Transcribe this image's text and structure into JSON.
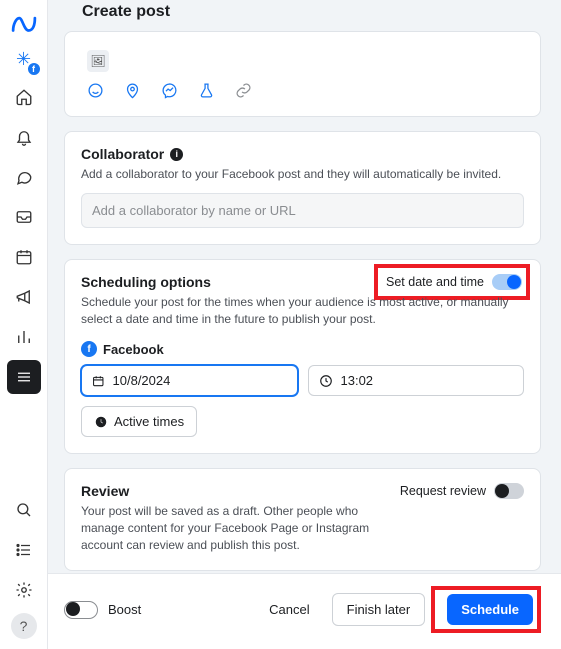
{
  "header": {
    "title": "Create post"
  },
  "collaborator": {
    "title": "Collaborator",
    "desc": "Add a collaborator to your Facebook post and they will automatically be invited.",
    "placeholder": "Add a collaborator by name or URL"
  },
  "scheduling": {
    "title": "Scheduling options",
    "toggle_label": "Set date and time",
    "desc": "Schedule your post for the times when your audience is most active, or manually select a date and time in the future to publish your post.",
    "platform": "Facebook",
    "date_value": "10/8/2024",
    "time_value": "13:02",
    "active_times": "Active times"
  },
  "review": {
    "title": "Review",
    "toggle_label": "Request review",
    "desc": "Your post will be saved as a draft. Other people who manage content for your Facebook Page or Instagram account can review and publish this post."
  },
  "footer": {
    "boost": "Boost",
    "cancel": "Cancel",
    "finish_later": "Finish later",
    "schedule": "Schedule"
  },
  "icons": {
    "emoji": "emoji",
    "location": "location",
    "messenger": "messenger",
    "flask": "flask",
    "link": "link"
  }
}
